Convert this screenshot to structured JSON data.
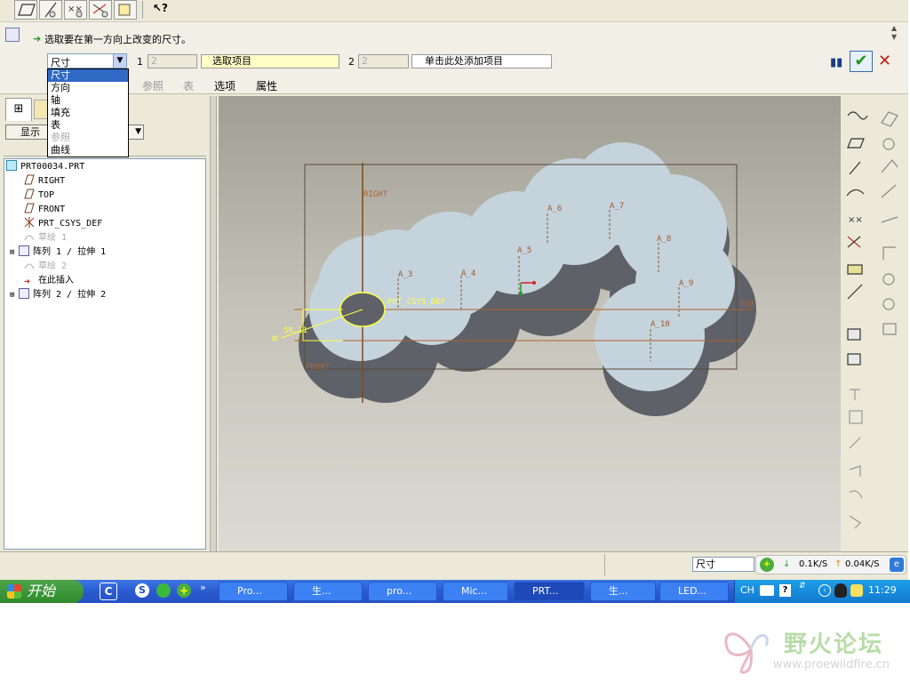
{
  "window": {
    "prompt": "选取要在第一方向上改变的尺寸。",
    "dropdown_value": "尺寸",
    "dropdown_options": [
      "尺寸",
      "方向",
      "轴",
      "填充",
      "表",
      "参照",
      "曲线"
    ],
    "dir1_label": "1",
    "dir1_count": "2",
    "dir1_select": "选取项目",
    "dir2_label": "2",
    "dir2_count": "2",
    "dir2_add": "单击此处添加项目",
    "tabs": [
      "参照",
      "表",
      "选项",
      "属性"
    ],
    "display_button": "显示"
  },
  "model_tree": {
    "items": [
      {
        "label": "PRT00034.PRT",
        "icon": "part-icon"
      },
      {
        "label": "RIGHT",
        "icon": "datum-plane-icon"
      },
      {
        "label": "TOP",
        "icon": "datum-plane-icon"
      },
      {
        "label": "FRONT",
        "icon": "datum-plane-icon"
      },
      {
        "label": "PRT_CSYS_DEF",
        "icon": "csys-icon"
      },
      {
        "label": "草绘 1",
        "icon": "sketch-icon"
      },
      {
        "label": "阵列 1 / 拉伸 1",
        "icon": "pattern-icon"
      },
      {
        "label": "草绘 2",
        "icon": "sketch-icon"
      },
      {
        "label": "在此插入",
        "icon": "insert-arrow-icon"
      },
      {
        "label": "阵列 2 / 拉伸 2",
        "icon": "pattern-icon"
      }
    ]
  },
  "viewport": {
    "plane_labels": {
      "right": "RIGHT",
      "top": "TOP",
      "front": "FRONT"
    },
    "csys_label": "PRT_CSYS_DEF",
    "axes": [
      "A_3",
      "A_4",
      "A_5",
      "A_6",
      "A_7",
      "A_8",
      "A_9",
      "A_10"
    ],
    "dimension": "58.11",
    "dim_prefix": "⌀"
  },
  "status_bar": {
    "filter_value": "尺寸",
    "download_speed": "0.1K/S",
    "upload_speed": "0.04K/S"
  },
  "taskbar": {
    "start_label": "开始",
    "tasks": [
      "Pro...",
      "生...",
      "pro...",
      "Mic...",
      "PRT...",
      "生...",
      "LED...",
      "CH"
    ],
    "clock": "11:29"
  },
  "watermark": {
    "title": "野火论坛",
    "url": "www.proewildfire.cn"
  },
  "colors": {
    "model_top": "#c5d3dd",
    "model_side": "#5e6168",
    "datum": "#b0622a",
    "selection": "#ffff40",
    "accent_green": "#2e8a2b"
  }
}
